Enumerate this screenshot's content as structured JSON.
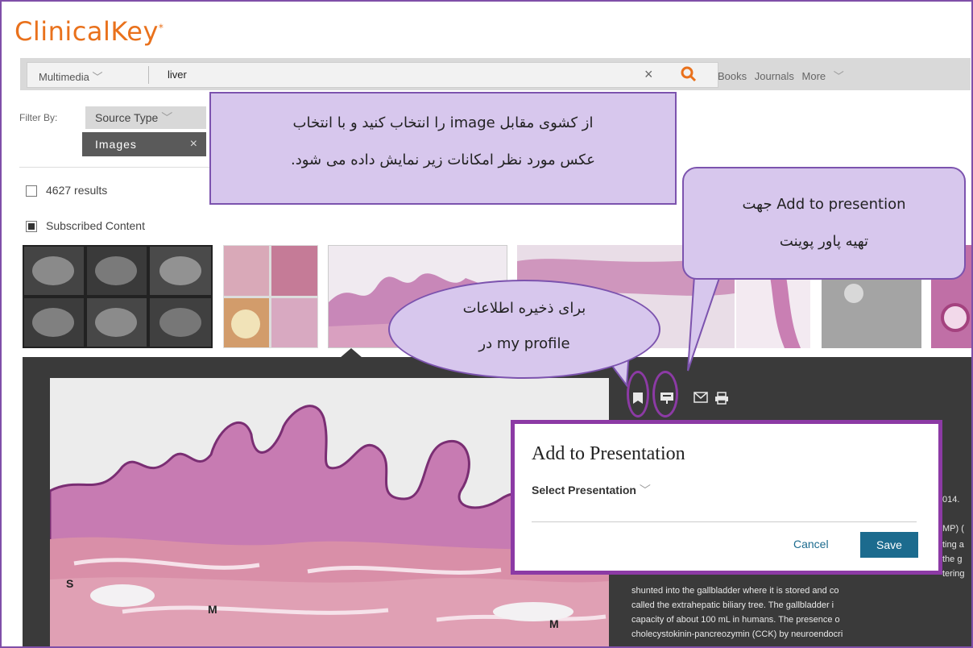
{
  "brand": {
    "name": "ClinicalKey",
    "mark": "*"
  },
  "search": {
    "scope": "Multimedia",
    "query": "liver",
    "clear": "×",
    "links": [
      "Books",
      "Journals",
      "More"
    ]
  },
  "filters": {
    "label": "Filter By:",
    "source_type": "Source Type",
    "chip": "Images",
    "chip_close": "×"
  },
  "results": {
    "count": "4627 results",
    "subscribed": "Subscribed Content"
  },
  "modal": {
    "title": "Add to Presentation",
    "select": "Select Presentation",
    "cancel": "Cancel",
    "save": "Save"
  },
  "figure_labels": {
    "s": "S",
    "m1": "M",
    "m2": "M"
  },
  "description": {
    "lines": [
      "shunted into the gallbladder where it is stored and co",
      "called the extrahepatic biliary tree. The gallbladder i",
      "capacity of about 100 mL in humans. The presence o",
      "cholecystokinin-pancreozymin (CCK) by neuroendocri"
    ],
    "partials": [
      "014.",
      "MP) (",
      "ting a",
      "the g",
      "tering"
    ]
  },
  "annotations": {
    "note1_line1": "از کشوی مقابل image را انتخاب کنید و با انتخاب",
    "note1_line2": "عکس مورد نظر امکانات زیر نمایش داده می شود.",
    "note2_line1": "Add to presention جهت",
    "note2_line2": "تهیه پاور پوینت",
    "note3_line1": "برای ذخیره اطلاعات",
    "note3_line2": "my profile در"
  },
  "colors": {
    "accent": "#e9711c",
    "annotation_fill": "#d7c7ed",
    "annotation_border": "#7c53ae",
    "highlight": "#8c3aa5",
    "primary_button": "#1c6b8e"
  }
}
